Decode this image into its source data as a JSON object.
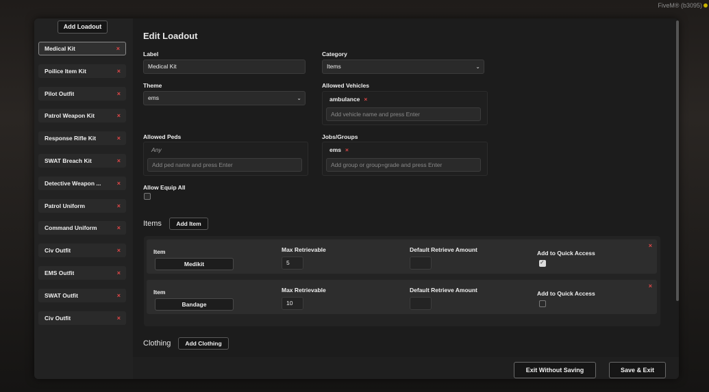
{
  "background": {
    "tag": "FiveM® (b3095)"
  },
  "sidebar": {
    "add_label": "Add Loadout",
    "remove_glyph": "×",
    "items": [
      {
        "label": "Medical Kit",
        "active": true
      },
      {
        "label": "Poilice Item Kit"
      },
      {
        "label": "Pilot Outfit"
      },
      {
        "label": "Patrol Weapon Kit"
      },
      {
        "label": "Response Rifle Kit"
      },
      {
        "label": "SWAT Breach Kit"
      },
      {
        "label": "Detective Weapon ..."
      },
      {
        "label": "Patrol Uniform"
      },
      {
        "label": "Command Uniform"
      },
      {
        "label": "Civ Outfit"
      },
      {
        "label": "EMS Outfit"
      },
      {
        "label": "SWAT Outfit"
      },
      {
        "label": "Civ Outfit"
      }
    ]
  },
  "editor": {
    "title": "Edit Loadout",
    "label": {
      "title": "Label",
      "value": "Medical Kit"
    },
    "category": {
      "title": "Category",
      "value": "Items"
    },
    "theme": {
      "title": "Theme",
      "value": "ems"
    },
    "allowed_vehicles": {
      "title": "Allowed Vehicles",
      "tags": [
        "ambulance"
      ],
      "placeholder": "Add vehicle name and press Enter"
    },
    "allowed_peds": {
      "title": "Allowed Peds",
      "empty_text": "Any",
      "placeholder": "Add ped name and press Enter"
    },
    "jobs_groups": {
      "title": "Jobs/Groups",
      "tags": [
        "ems"
      ],
      "placeholder": "Add group or group=grade and press Enter"
    },
    "allow_equip_all": {
      "title": "Allow Equip All",
      "checked": false
    },
    "items_section": {
      "title": "Items",
      "add_label": "Add Item",
      "col_item": "Item",
      "col_max": "Max Retrievable",
      "col_default": "Default Retrieve Amount",
      "col_quick": "Add to Quick Access",
      "rows": [
        {
          "name": "Medikit",
          "max": "5",
          "default": "",
          "quick_access": true
        },
        {
          "name": "Bandage",
          "max": "10",
          "default": "",
          "quick_access": false
        }
      ]
    },
    "clothing_section": {
      "title": "Clothing",
      "add_label": "Add Clothing"
    },
    "exit_label": "Exit Without Saving",
    "save_label": "Save & Exit"
  },
  "colors": {
    "accent_remove": "#e04848",
    "panel": "#1c1c1c",
    "sidebar": "#222222"
  },
  "icons": {
    "remove": "close-icon",
    "dropdown": "chevron-down-icon",
    "checkbox": "check-icon"
  }
}
